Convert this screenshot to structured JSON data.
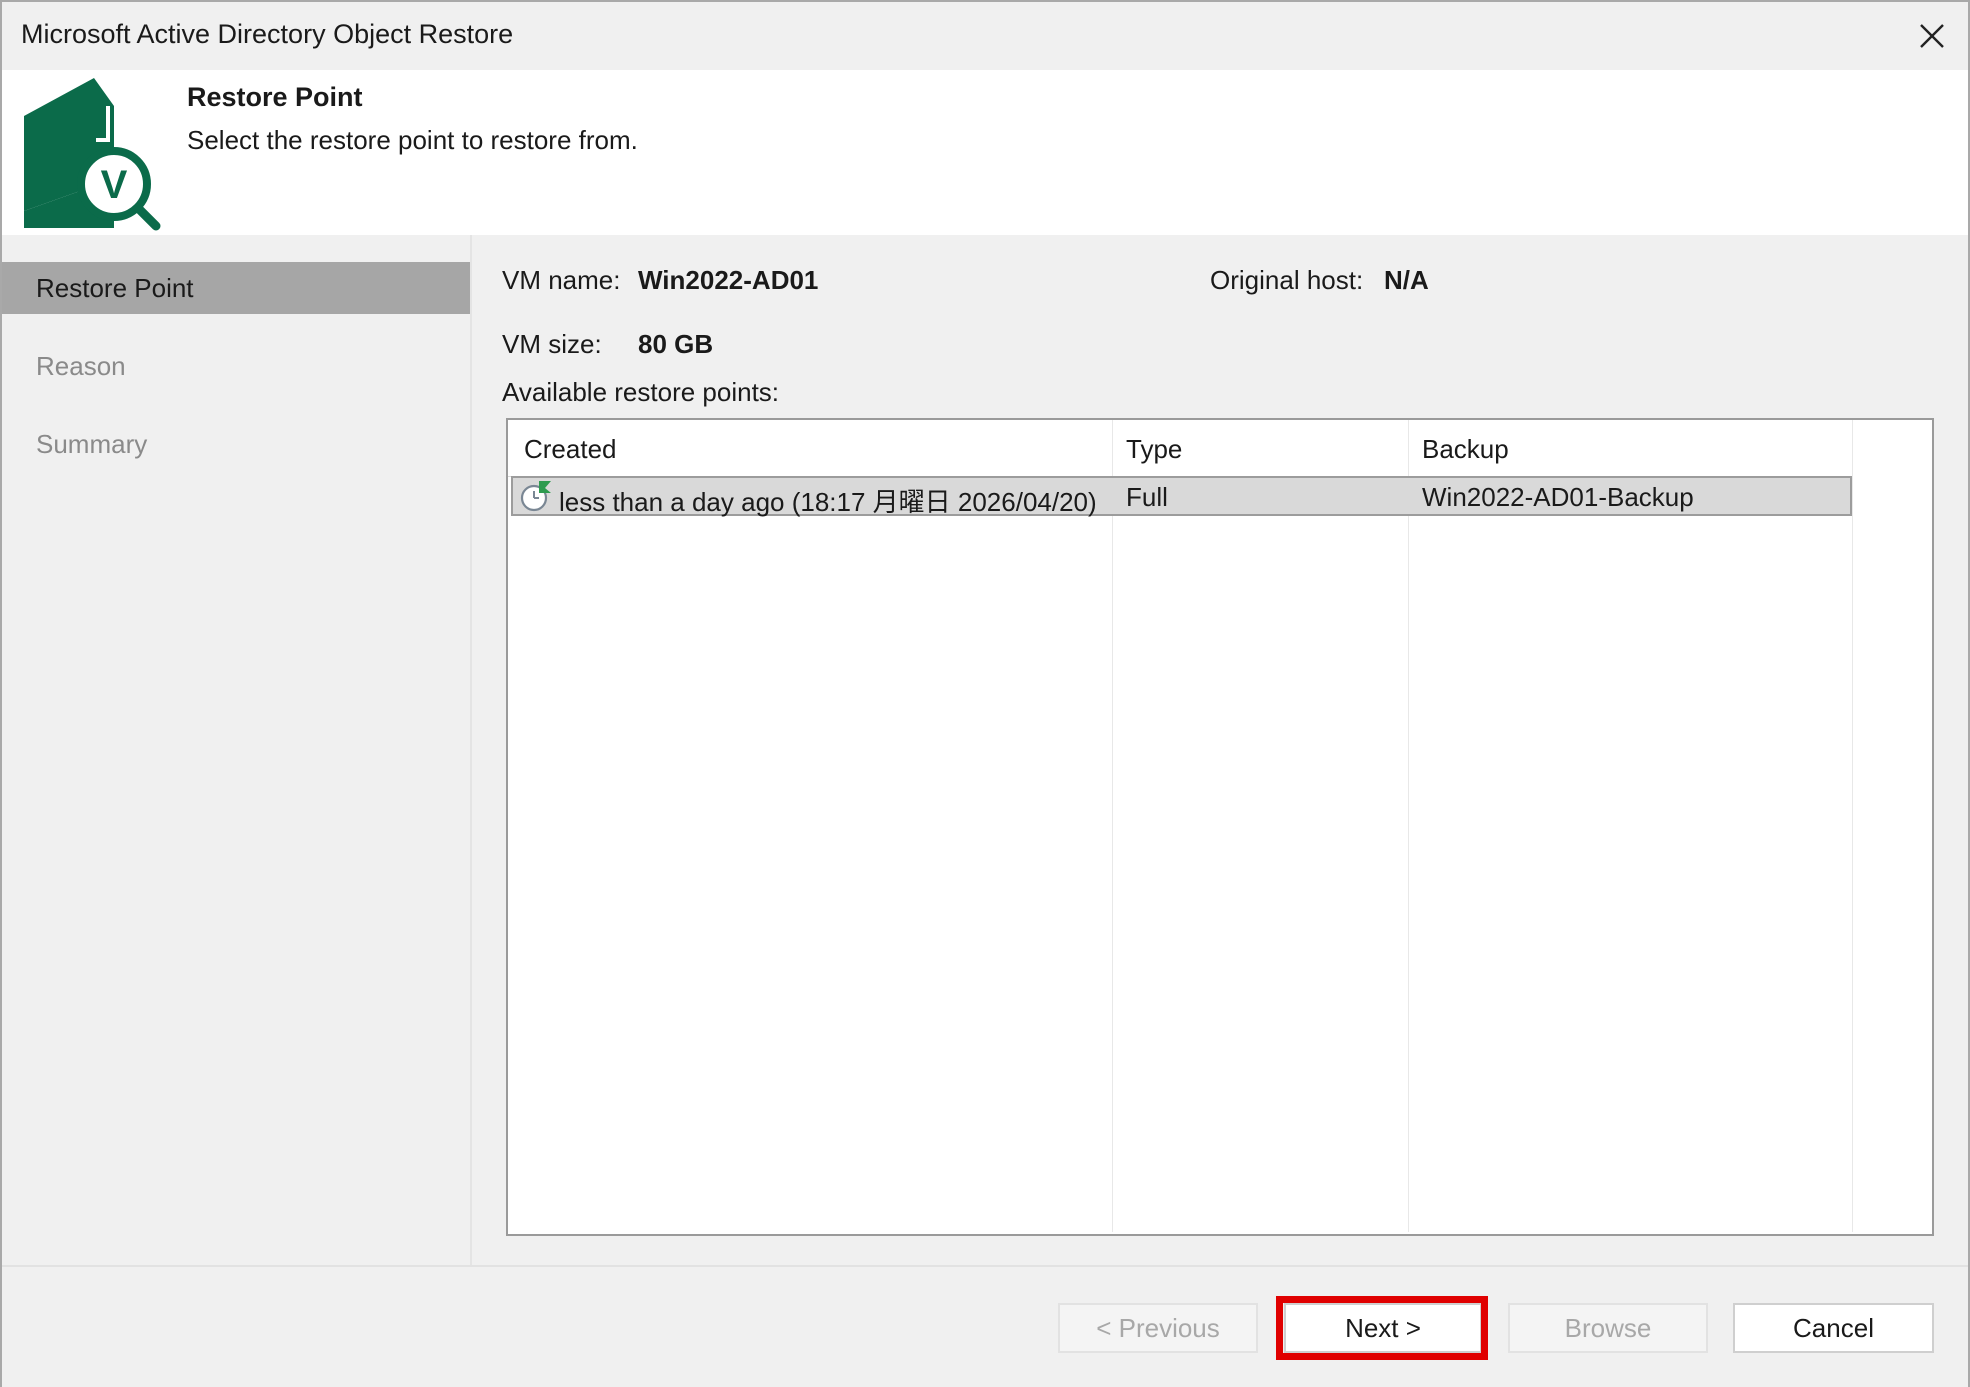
{
  "window": {
    "title": "Microsoft Active Directory Object Restore"
  },
  "header": {
    "title": "Restore Point",
    "subtitle": "Select the restore point to restore from."
  },
  "sidebar": {
    "items": [
      {
        "label": "Restore Point",
        "state": "active"
      },
      {
        "label": "Reason",
        "state": "inactive"
      },
      {
        "label": "Summary",
        "state": "inactive"
      }
    ]
  },
  "info": {
    "vm_name_label": "VM name:",
    "vm_name_value": "Win2022-AD01",
    "original_host_label": "Original host:",
    "original_host_value": "N/A",
    "vm_size_label": "VM size:",
    "vm_size_value": "80 GB",
    "available_label": "Available restore points:"
  },
  "table": {
    "columns": [
      "Created",
      "Type",
      "Backup"
    ],
    "rows": [
      {
        "created": "less than a day ago (18:17 月曜日 2026/04/20)",
        "type": "Full",
        "backup": "Win2022-AD01-Backup",
        "selected": true
      }
    ]
  },
  "footer": {
    "previous_label": "< Previous",
    "next_label": "Next >",
    "browse_label": "Browse",
    "cancel_label": "Cancel"
  },
  "colors": {
    "brand_green": "#0b6b4a",
    "highlight_red": "#e00000",
    "selected_row": "#d9d9d9",
    "active_step": "#a6a6a6"
  }
}
